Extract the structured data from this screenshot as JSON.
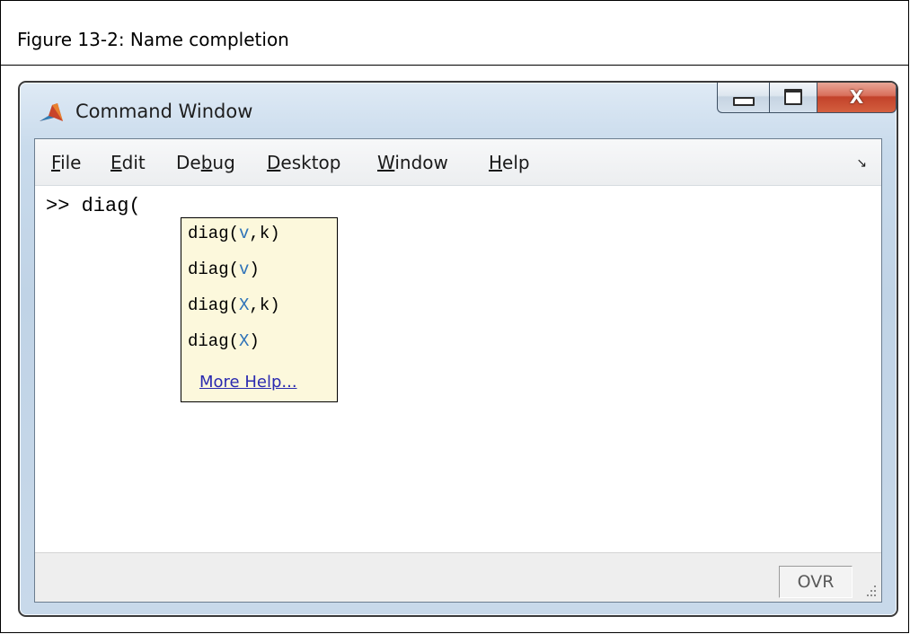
{
  "caption": {
    "text": "Figure 13-2: Name completion"
  },
  "window": {
    "title": "Command Window",
    "icon": "matlab-logo-icon",
    "buttons": {
      "minimize": "minimize-icon",
      "maximize": "maximize-icon",
      "close": "close-icon"
    }
  },
  "menubar": {
    "items": [
      {
        "label": "File",
        "mnemonic_index": 0
      },
      {
        "label": "Edit",
        "mnemonic_index": 0
      },
      {
        "label": "Debug",
        "mnemonic_index": 2
      },
      {
        "label": "Desktop",
        "mnemonic_index": 0
      },
      {
        "label": "Window",
        "mnemonic_index": 0
      },
      {
        "label": "Help",
        "mnemonic_index": 0
      }
    ],
    "dock_icon": "undock-arrow-icon"
  },
  "console": {
    "prompt": ">>",
    "input": "diag("
  },
  "completion": {
    "items": [
      {
        "fn": "diag",
        "open": "(",
        "args": [
          "v",
          "k"
        ],
        "close": ")",
        "arg_color_indices": [
          0
        ]
      },
      {
        "fn": "diag",
        "open": "(",
        "args": [
          "v"
        ],
        "close": ")",
        "arg_color_indices": [
          0
        ]
      },
      {
        "fn": "diag",
        "open": "(",
        "args": [
          "X",
          "k"
        ],
        "close": ")",
        "arg_color_indices": [
          0
        ]
      },
      {
        "fn": "diag",
        "open": "(",
        "args": [
          "X"
        ],
        "close": ")",
        "arg_color_indices": [
          0
        ]
      }
    ],
    "more_help": "More Help...",
    "arg_color": "#2f73b8",
    "background": "#fcf8dc"
  },
  "statusbar": {
    "mode": "OVR",
    "grip_icon": "resize-grip-icon"
  }
}
